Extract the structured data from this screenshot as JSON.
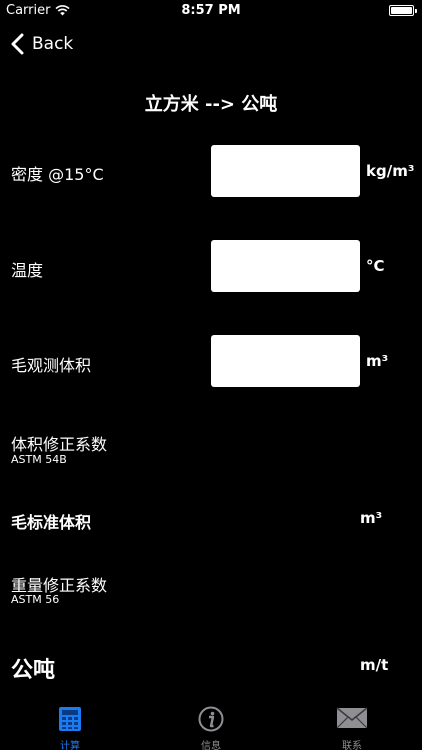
{
  "status": {
    "carrier": "Carrier",
    "time": "8:57 PM"
  },
  "nav": {
    "back_label": "Back"
  },
  "title": "立方米 --> 公吨",
  "form": {
    "density": {
      "label": "密度 @15°C",
      "value": "",
      "unit": "kg/m³"
    },
    "temperature": {
      "label": "温度",
      "value": "",
      "unit": "°C"
    },
    "gross_volume": {
      "label": "毛观测体积",
      "value": "",
      "unit": "m³"
    },
    "volume_correction": {
      "label": "体积修正系数",
      "sub": "ASTM 54B"
    },
    "gross_standard_volume": {
      "label": "毛标准体积",
      "unit": "m³"
    },
    "weight_correction": {
      "label": "重量修正系数",
      "sub": "ASTM 56"
    },
    "tonnes": {
      "label": "公吨",
      "unit": "m/t"
    }
  },
  "tabs": [
    {
      "label": "计算",
      "icon": "calculator-icon",
      "active": true
    },
    {
      "label": "信息",
      "icon": "info-icon",
      "active": false
    },
    {
      "label": "联系",
      "icon": "mail-icon",
      "active": false
    }
  ],
  "colors": {
    "background": "#000000",
    "accent": "#1a7cf5",
    "inactive": "#8e8e93"
  }
}
